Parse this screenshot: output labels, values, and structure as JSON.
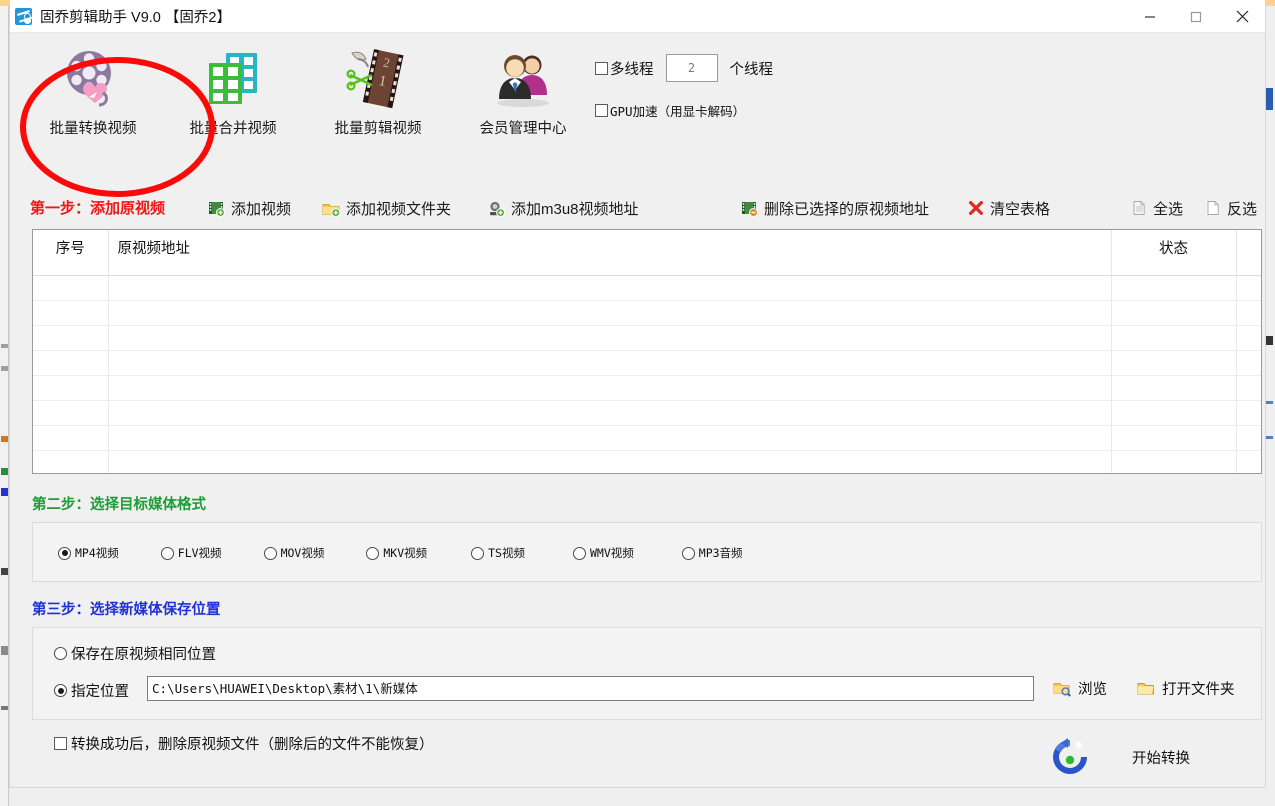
{
  "window": {
    "title": "固乔剪辑助手 V9.0  【固乔2】",
    "app_icon": "scissors-icon",
    "controls": {
      "minimize": "minimize-icon",
      "maximize": "maximize-icon",
      "close": "close-icon"
    }
  },
  "toolbar": {
    "buttons": [
      {
        "label": "批量转换视频",
        "icon": "film-reel-icon",
        "selected": true
      },
      {
        "label": "批量合并视频",
        "icon": "merge-clips-icon",
        "selected": false
      },
      {
        "label": "批量剪辑视频",
        "icon": "film-strip-scissors-icon",
        "selected": false
      },
      {
        "label": "会员管理中心",
        "icon": "members-icon",
        "selected": false
      }
    ],
    "options": {
      "multithread_label": "多线程",
      "multithread_checked": false,
      "thread_count": "2",
      "thread_unit": "个线程",
      "gpu_label": "GPU加速（用显卡解码）",
      "gpu_checked": false
    }
  },
  "annotation": {
    "highlight_color": "#fb0a0a",
    "highlight_target": "批量转换视频"
  },
  "step1": {
    "title": "第一步：添加原视频",
    "title_color": "#f01616",
    "actions": [
      {
        "label": "添加视频",
        "icon": "add-video-icon"
      },
      {
        "label": "添加视频文件夹",
        "icon": "add-folder-icon"
      },
      {
        "label": "添加m3u8视频地址",
        "icon": "add-m3u8-icon"
      },
      {
        "label": "删除已选择的原视频地址",
        "icon": "delete-video-icon"
      },
      {
        "label": "清空表格",
        "icon": "clear-table-icon"
      },
      {
        "label": "全选",
        "icon": "select-all-icon"
      },
      {
        "label": "反选",
        "icon": "invert-selection-icon"
      }
    ]
  },
  "table": {
    "columns": [
      "序号",
      "原视频地址",
      "状态",
      ""
    ],
    "rows": [],
    "empty_row_count": 8
  },
  "step2": {
    "title": "第二步：选择目标媒体格式",
    "title_color": "#1f9b38",
    "formats": [
      {
        "label": "MP4视频",
        "selected": true
      },
      {
        "label": "FLV视频",
        "selected": false
      },
      {
        "label": "MOV视频",
        "selected": false
      },
      {
        "label": "MKV视频",
        "selected": false
      },
      {
        "label": "TS视频",
        "selected": false
      },
      {
        "label": "WMV视频",
        "selected": false
      },
      {
        "label": "MP3音频",
        "selected": false
      }
    ]
  },
  "step3": {
    "title": "第三步：选择新媒体保存位置",
    "title_color": "#2032d6",
    "same_location_label": "保存在原视频相同位置",
    "same_location_selected": false,
    "custom_location_label": "指定位置",
    "custom_location_selected": true,
    "path_value": "C:\\Users\\HUAWEI\\Desktop\\素材\\1\\新媒体",
    "browse_label": "浏览",
    "browse_icon": "browse-folder-icon",
    "open_folder_label": "打开文件夹",
    "open_folder_icon": "open-folder-icon"
  },
  "bottom": {
    "delete_source_label": "转换成功后，删除原视频文件（删除后的文件不能恢复）",
    "delete_source_checked": false,
    "start_label": "开始转换",
    "start_icon": "convert-refresh-icon"
  }
}
